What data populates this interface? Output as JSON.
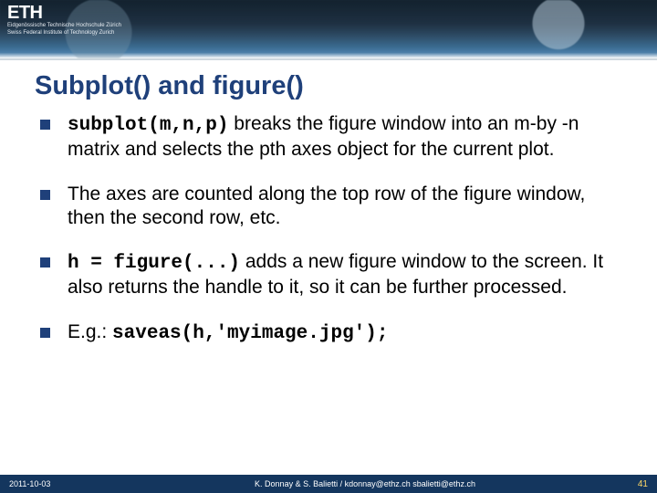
{
  "header": {
    "logo_text": "ETH",
    "subtitle_line1": "Eidgenössische Technische Hochschule Zürich",
    "subtitle_line2": "Swiss Federal Institute of Technology Zurich"
  },
  "title": "Subplot() and figure()",
  "bullets": [
    {
      "code1": "subplot(m,n,p)",
      "text1": " breaks the figure window into an m-by -n matrix and selects the pth axes object for the current plot."
    },
    {
      "text1": "The axes are counted along the top row of the figure window, then the second row, etc."
    },
    {
      "code1": "h = figure(...)",
      "text1": " adds a new figure window to the screen. It also returns the handle to it, so it can be further processed."
    },
    {
      "text1": "E.g.: ",
      "code2": "saveas(h,'myimage.jpg');"
    }
  ],
  "footer": {
    "date": "2011-10-03",
    "center": "K. Donnay & S. Balietti / kdonnay@ethz.ch sbalietti@ethz.ch",
    "page": "41"
  }
}
